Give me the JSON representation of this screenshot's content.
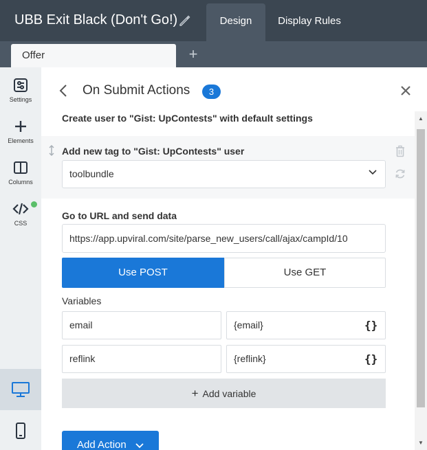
{
  "header": {
    "title": "UBB Exit Black (Don't Go!)",
    "tabs": [
      {
        "label": "Design",
        "active": true
      },
      {
        "label": "Display Rules",
        "active": false
      }
    ]
  },
  "subtabs": {
    "items": [
      {
        "label": "Offer",
        "active": true
      }
    ],
    "add_symbol": "+"
  },
  "sidebar": {
    "items": [
      {
        "label": "Settings",
        "icon": "settings-icon"
      },
      {
        "label": "Elements",
        "icon": "plus-icon"
      },
      {
        "label": "Columns",
        "icon": "columns-icon"
      },
      {
        "label": "CSS",
        "icon": "code-icon"
      }
    ],
    "devices": [
      "desktop",
      "mobile"
    ],
    "active_device": "desktop"
  },
  "panel": {
    "title": "On Submit Actions",
    "count": "3",
    "action1": {
      "label": "Create user to \"Gist: UpContests\" with default settings"
    },
    "action2": {
      "label": "Add new tag to \"Gist: UpContests\" user",
      "selected_tag": "toolbundle"
    },
    "action3": {
      "label": "Go to URL and send data",
      "url": "https://app.upviral.com/site/parse_new_users/call/ajax/campId/10",
      "method_post": "Use POST",
      "method_get": "Use GET",
      "selected_method": "POST",
      "variables_label": "Variables",
      "variables": [
        {
          "name": "email",
          "value": "{email}"
        },
        {
          "name": "reflink",
          "value": "{reflink}"
        }
      ],
      "braces_symbol": "{}",
      "add_variable_label": "Add variable",
      "add_variable_symbol": "+"
    },
    "add_action_label": "Add Action"
  },
  "colors": {
    "topbar": "#3b4651",
    "accent": "#1a78d8",
    "css_dot": "#5bbf6a"
  }
}
